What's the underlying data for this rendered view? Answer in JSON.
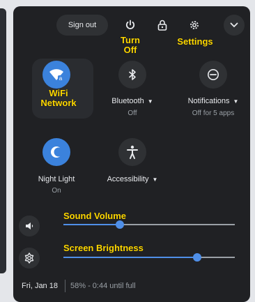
{
  "header": {
    "sign_out_label": "Sign out",
    "icons": [
      "power-icon",
      "lock-icon",
      "gear-icon",
      "chevron-down-icon"
    ]
  },
  "callouts": {
    "turn_off": "Turn\nOff",
    "settings": "Settings",
    "wifi": "WiFi\nNetwork",
    "sound_volume": "Sound Volume",
    "screen_brightness": "Screen Brightness"
  },
  "features": [
    {
      "name": "wifi",
      "icon": "wifi-icon",
      "label": "",
      "sublabel": "",
      "state": "on"
    },
    {
      "name": "bluetooth",
      "icon": "bluetooth-icon",
      "label": "Bluetooth",
      "sublabel": "Off",
      "state": "off"
    },
    {
      "name": "notifications",
      "icon": "notifications-icon",
      "label": "Notifications",
      "sublabel": "Off for 5 apps",
      "state": "off"
    },
    {
      "name": "night-light",
      "icon": "night-light-icon",
      "label": "Night Light",
      "sublabel": "On",
      "state": "on"
    },
    {
      "name": "accessibility",
      "icon": "accessibility-icon",
      "label": "Accessibility",
      "sublabel": "",
      "state": "off"
    }
  ],
  "sliders": {
    "volume": {
      "icon": "speaker-icon",
      "level": 0.33
    },
    "brightness": {
      "icon": "brightness-icon",
      "level": 0.78
    }
  },
  "footer": {
    "date": "Fri, Jan 18",
    "battery": "58% - 0:44 until full"
  },
  "colors": {
    "panel_bg": "#202124",
    "accent": "#4f8fe8",
    "callout": "#ffd800"
  }
}
